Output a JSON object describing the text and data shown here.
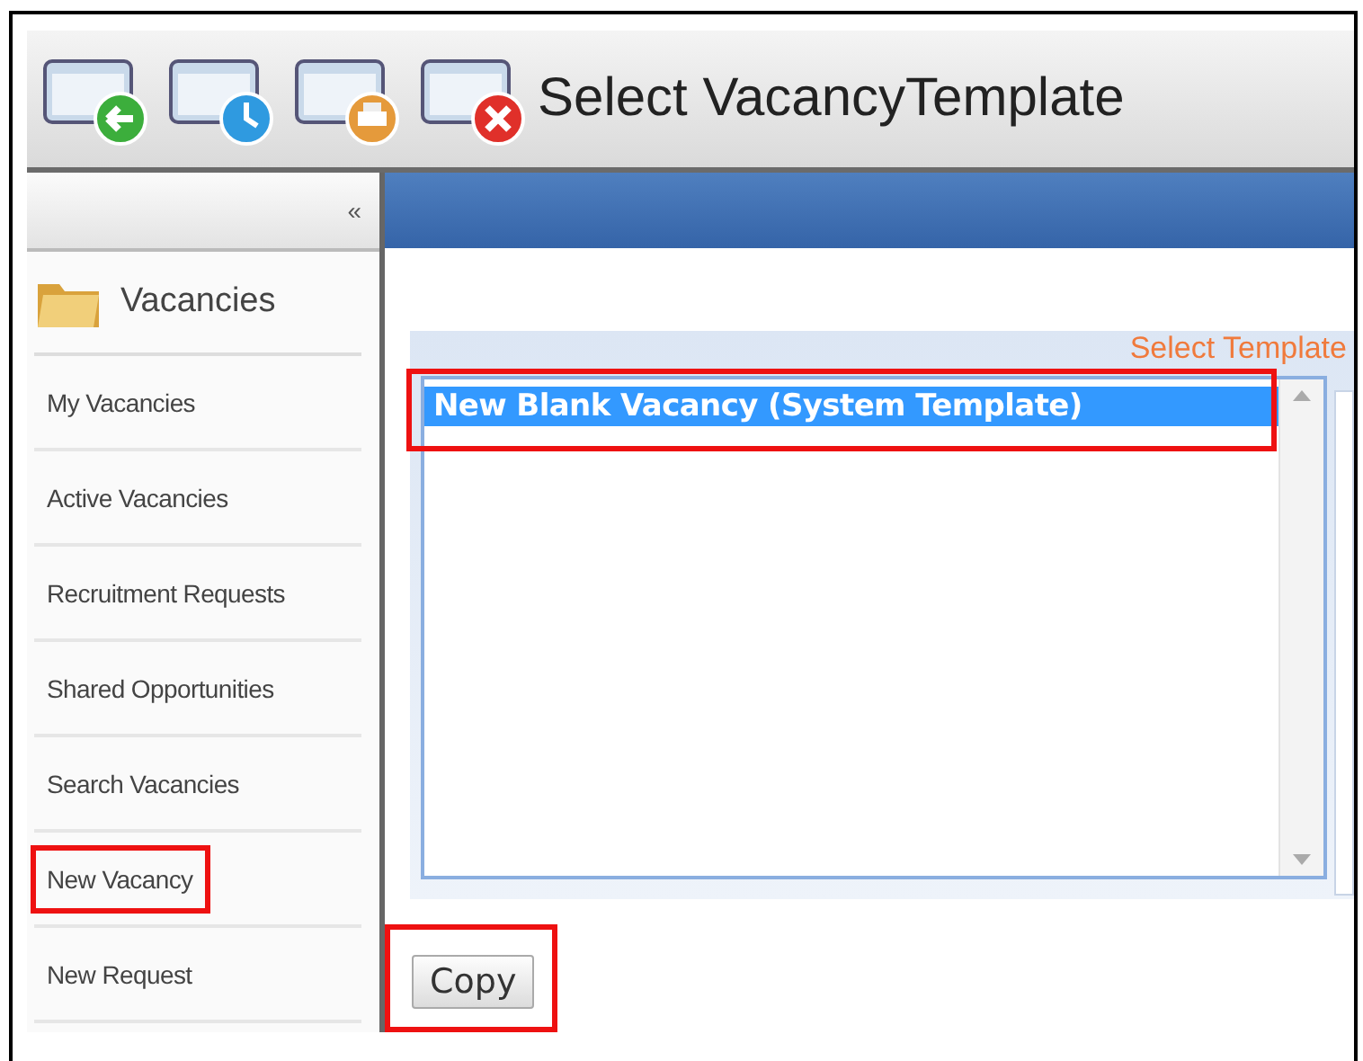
{
  "toolbar": {
    "buttons": [
      {
        "kind": "back"
      },
      {
        "kind": "history"
      },
      {
        "kind": "print"
      },
      {
        "kind": "close"
      }
    ],
    "title": "Select VacancyTemplate"
  },
  "sidebar": {
    "collapse": "«",
    "section": "Vacancies",
    "items": [
      {
        "label": "My Vacancies",
        "highlighted": false
      },
      {
        "label": "Active Vacancies",
        "highlighted": false
      },
      {
        "label": "Recruitment Requests",
        "highlighted": false
      },
      {
        "label": "Shared Opportunities",
        "highlighted": false
      },
      {
        "label": "Search Vacancies",
        "highlighted": false
      },
      {
        "label": "New Vacancy",
        "highlighted": true
      },
      {
        "label": "New Request",
        "highlighted": false
      }
    ]
  },
  "template_panel": {
    "label": "Select Template",
    "templates": [
      {
        "label": "New Blank Vacancy (System Template)",
        "selected": true,
        "highlighted": true
      }
    ]
  },
  "copy_button": {
    "label": "Copy",
    "highlighted": true
  }
}
